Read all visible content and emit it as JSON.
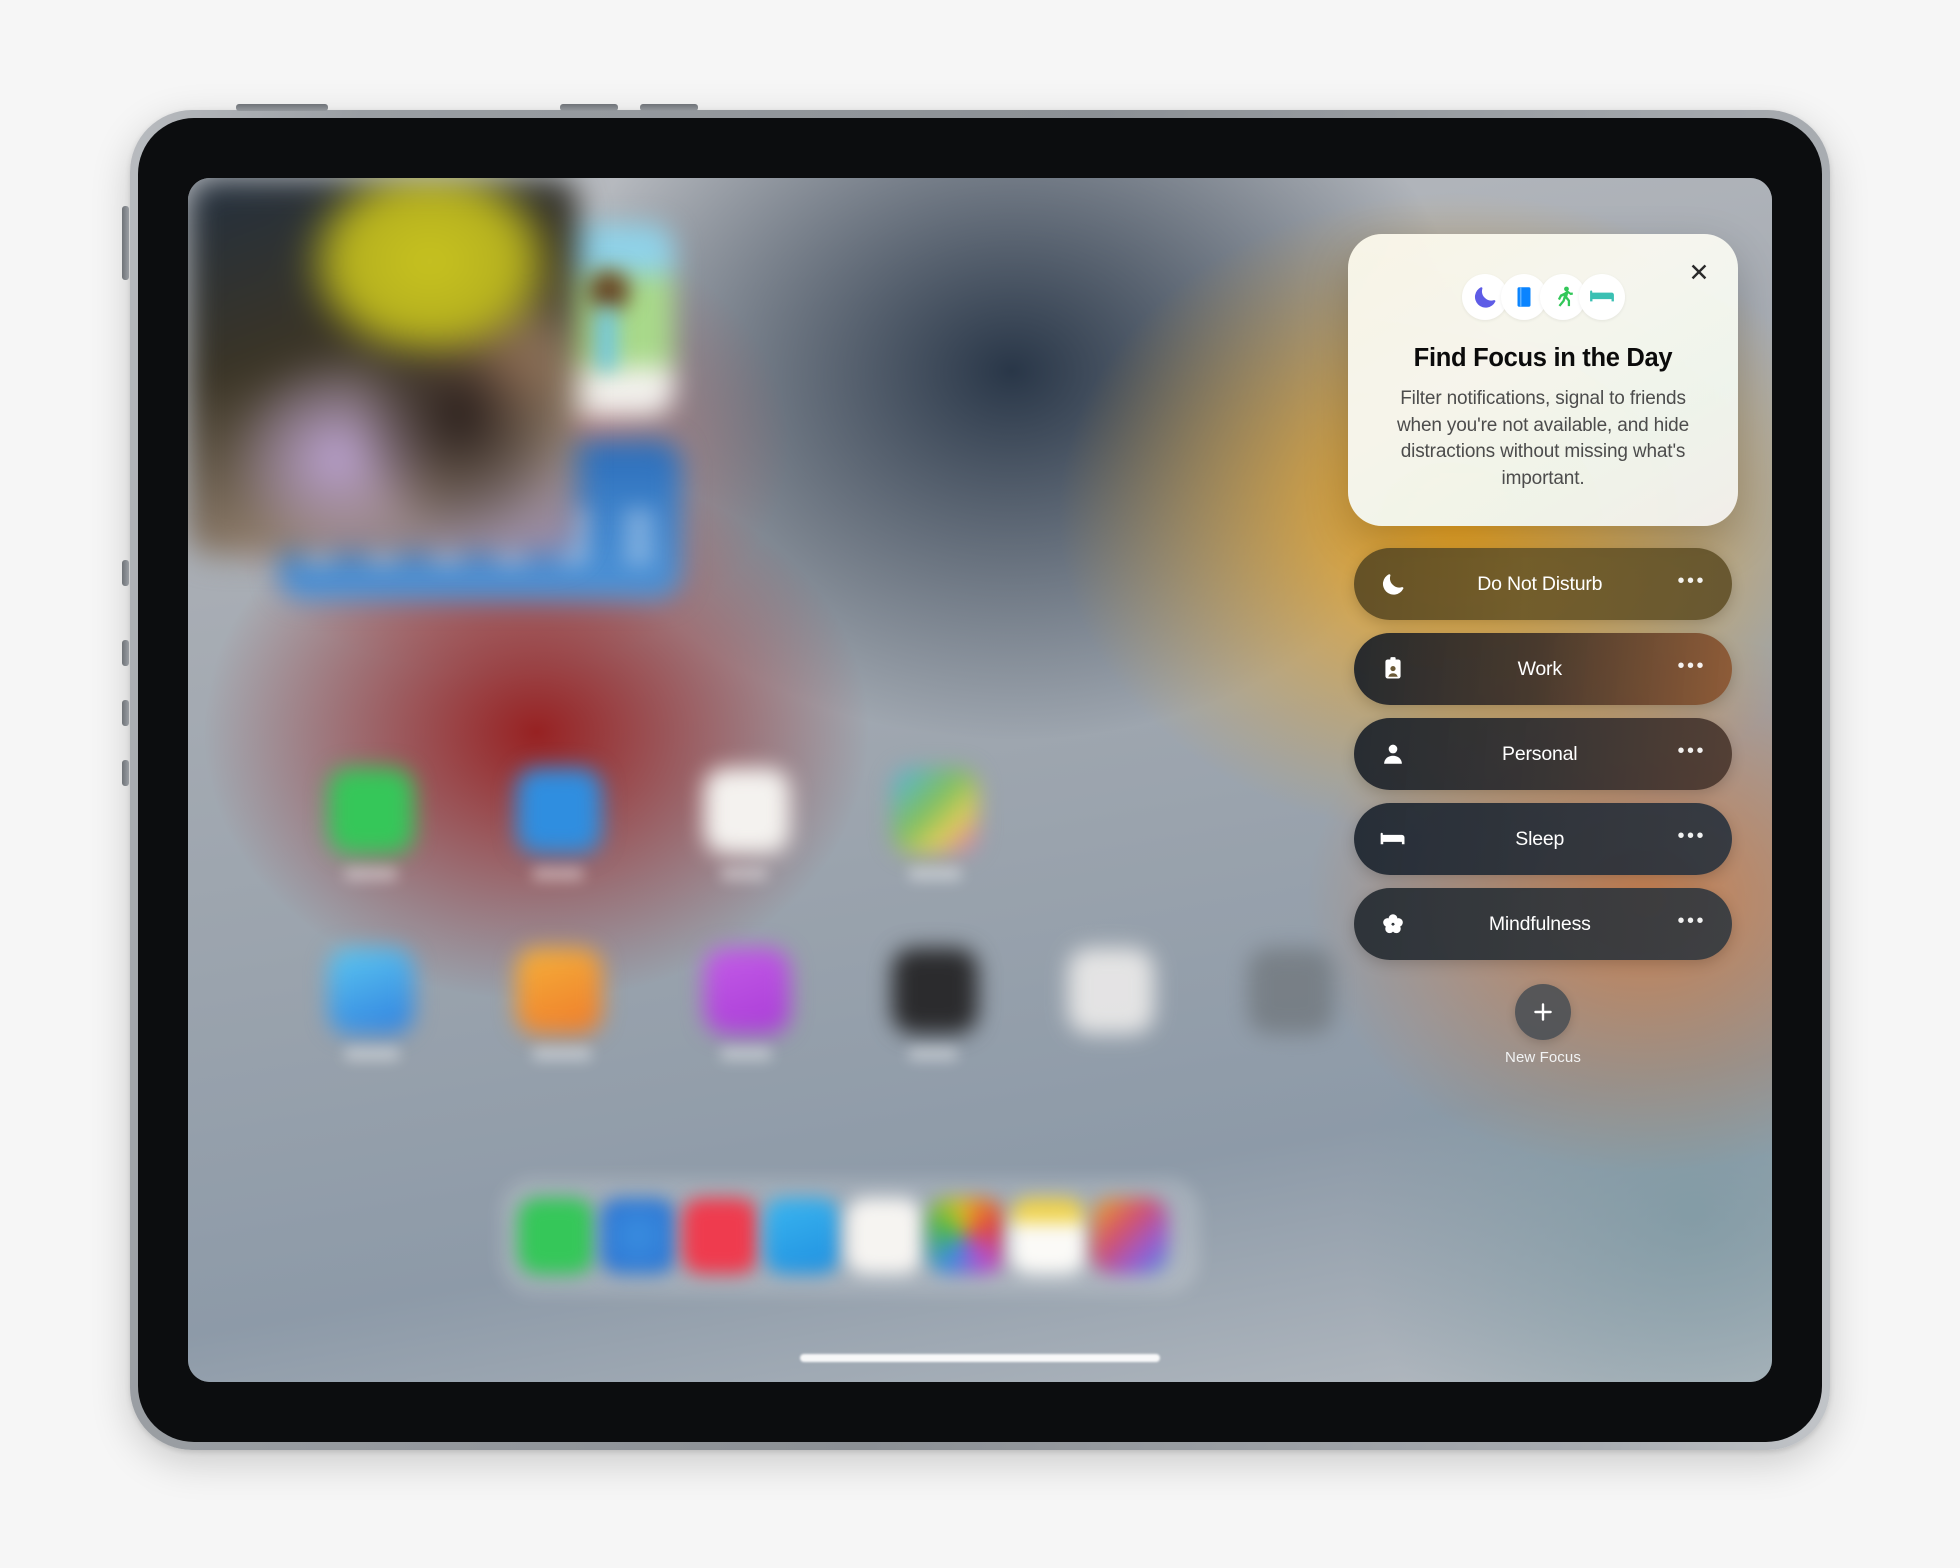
{
  "device": {
    "name": "iPad Pro",
    "frame_color": "#9a9ea3"
  },
  "card": {
    "title": "Find Focus in the Day",
    "body": "Filter notifications, signal to friends when you're not available, and hide distractions without missing what's important.",
    "close_label": "✕",
    "icons": [
      {
        "name": "moon-icon",
        "color": "#5e5ce6"
      },
      {
        "name": "book-icon",
        "color": "#0a84ff"
      },
      {
        "name": "running-person-icon",
        "color": "#32c759"
      },
      {
        "name": "bed-icon",
        "color": "#3ac0b3"
      }
    ]
  },
  "focus_modes": [
    {
      "label": "Do Not Disturb",
      "icon": "moon-icon",
      "more_label": "•••",
      "active": true
    },
    {
      "label": "Work",
      "icon": "badge-id-icon",
      "more_label": "•••",
      "active": false
    },
    {
      "label": "Personal",
      "icon": "person-icon",
      "more_label": "•••",
      "active": false
    },
    {
      "label": "Sleep",
      "icon": "bed-icon",
      "more_label": "•••",
      "active": false
    },
    {
      "label": "Mindfulness",
      "icon": "flower-icon",
      "more_label": "•••",
      "active": false
    }
  ],
  "new_focus": {
    "label": "New Focus",
    "icon": "plus-icon"
  },
  "home_screen": {
    "widgets": [
      {
        "name": "clock-widget",
        "color": "#d01a16"
      },
      {
        "name": "maps-widget",
        "color": "#a8d98a"
      },
      {
        "name": "weather-widget",
        "color": "#3f84cc"
      },
      {
        "name": "photos-widget",
        "color": "#b5b01e"
      }
    ],
    "app_row_1": [
      "#35c759",
      "#2f8ee0",
      "#f4f2ef",
      "#7fbf5f"
    ],
    "app_row_2": [
      "#4aa8e8",
      "#f2922a",
      "#bc5ae0",
      "#2b2b2d"
    ],
    "dock_apps": [
      "#35c759",
      "#2f8ee0",
      "#ef3b4e",
      "#3ab6f0",
      "#f6f4f1",
      "#e8a020",
      "#f0d34a",
      "#c74fc0"
    ],
    "home_indicator": "home-indicator"
  }
}
